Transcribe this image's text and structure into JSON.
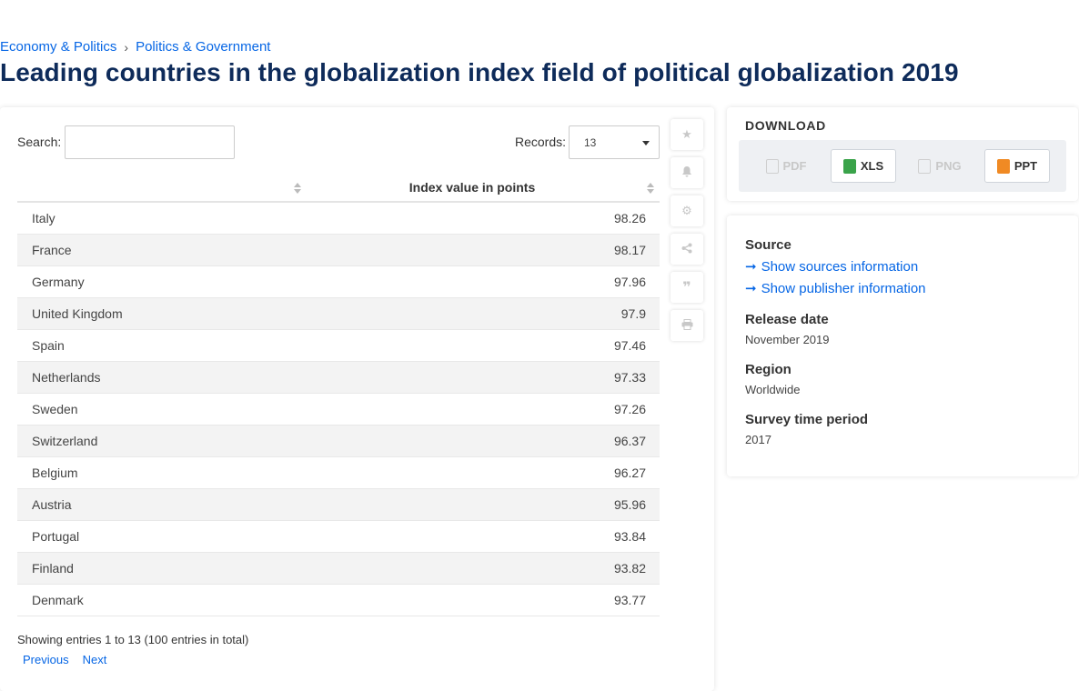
{
  "breadcrumb": {
    "item1": "Economy & Politics",
    "separator": "›",
    "item2": "Politics & Government"
  },
  "title": "Leading countries in the globalization index field of political globalization 2019",
  "controls": {
    "search_label": "Search:",
    "search_value": "",
    "records_label": "Records:",
    "records_value": "13"
  },
  "table": {
    "columns": [
      "",
      "Index value in points"
    ],
    "rows": [
      {
        "country": "Italy",
        "value": "98.26"
      },
      {
        "country": "France",
        "value": "98.17"
      },
      {
        "country": "Germany",
        "value": "97.96"
      },
      {
        "country": "United Kingdom",
        "value": "97.9"
      },
      {
        "country": "Spain",
        "value": "97.46"
      },
      {
        "country": "Netherlands",
        "value": "97.33"
      },
      {
        "country": "Sweden",
        "value": "97.26"
      },
      {
        "country": "Switzerland",
        "value": "96.37"
      },
      {
        "country": "Belgium",
        "value": "96.27"
      },
      {
        "country": "Austria",
        "value": "95.96"
      },
      {
        "country": "Portugal",
        "value": "93.84"
      },
      {
        "country": "Finland",
        "value": "93.82"
      },
      {
        "country": "Denmark",
        "value": "93.77"
      }
    ],
    "info": "Showing entries 1 to 13 (100 entries in total)",
    "prev": "Previous",
    "next": "Next"
  },
  "tools": [
    "star-icon",
    "bell-icon",
    "gear-icon",
    "share-icon",
    "quote-icon",
    "print-icon"
  ],
  "download": {
    "title": "DOWNLOAD",
    "buttons": [
      {
        "label": "PDF",
        "enabled": false
      },
      {
        "label": "XLS",
        "enabled": true
      },
      {
        "label": "PNG",
        "enabled": false
      },
      {
        "label": "PPT",
        "enabled": true
      }
    ]
  },
  "info": {
    "source_label": "Source",
    "sources_link": "Show sources information",
    "publisher_link": "Show publisher information",
    "release_label": "Release date",
    "release_value": "November 2019",
    "region_label": "Region",
    "region_value": "Worldwide",
    "survey_label": "Survey time period",
    "survey_value": "2017"
  },
  "colors": {
    "link": "#0666e5",
    "title": "#0e2b5a",
    "xls": "#3aa34a",
    "ppt": "#f08a24"
  }
}
